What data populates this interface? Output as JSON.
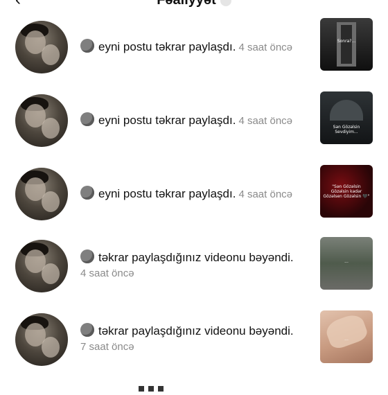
{
  "header": {
    "back_glyph": "‹",
    "title": "Fəaliyyət"
  },
  "items": [
    {
      "text": "eyni postu təkrar paylaşdı.",
      "time": "4 saat öncə",
      "time_inline": true,
      "thumb_caption": "Sonra?..."
    },
    {
      "text": "eyni postu təkrar paylaşdı.",
      "time": "4 saat öncə",
      "time_inline": true,
      "thumb_caption": "Sən Gözəlsin\nSevdiyim..."
    },
    {
      "text": "eyni postu təkrar paylaşdı.",
      "time": "4 saat öncə",
      "time_inline": true,
      "thumb_caption": "\"Sən Gözəlsin Gözəlsin kədər\nGözəlsen Gözəlsin 🖤\""
    },
    {
      "text": "təkrar paylaşdığınız videonu bəyəndi.",
      "time": "4 saat öncə",
      "time_inline": false,
      "thumb_caption": "..."
    },
    {
      "text": "təkrar paylaşdığınız videonu bəyəndi.",
      "time": "7 saat öncə",
      "time_inline": false,
      "thumb_caption": "..."
    }
  ],
  "icons": {
    "back": "chevron-left-icon",
    "emoji": "emoji-face-icon"
  }
}
